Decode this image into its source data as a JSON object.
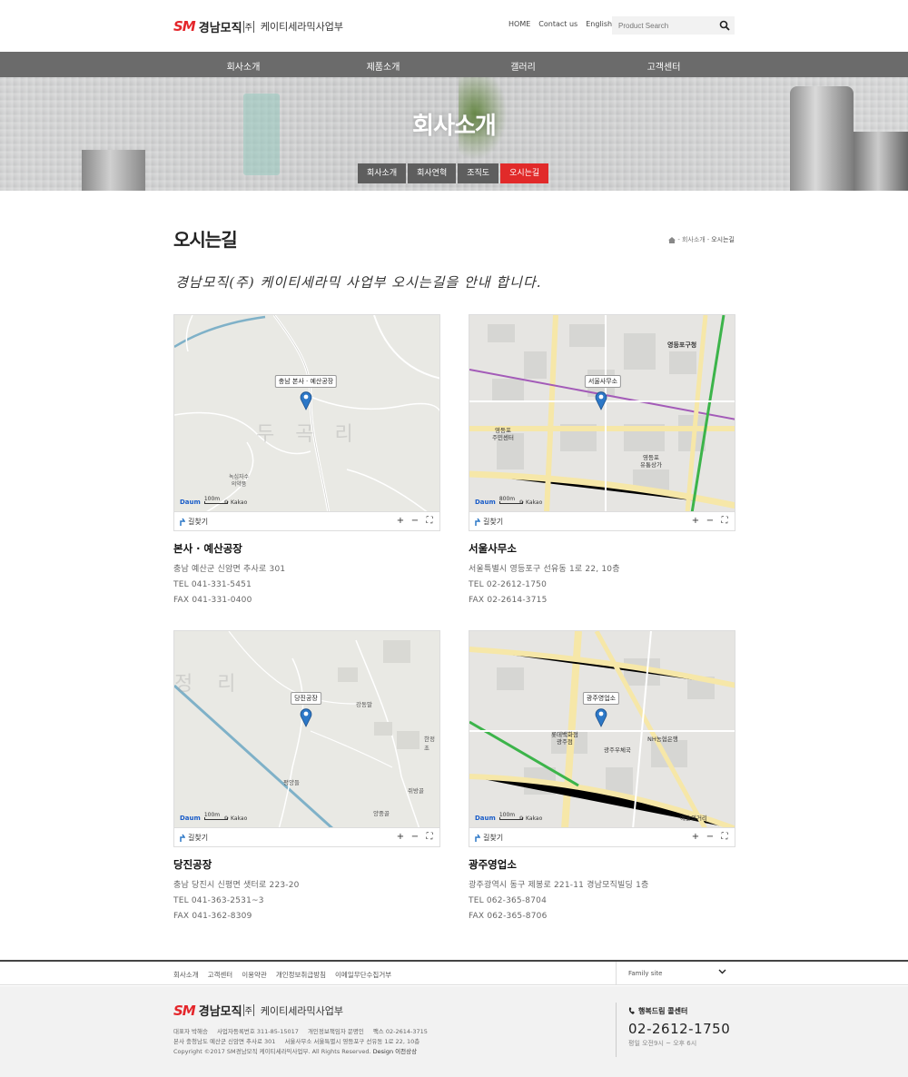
{
  "header": {
    "logo_sm": "SM",
    "logo_name": "경남모직",
    "logo_co": "주",
    "logo_division": "케이티세라믹사업부",
    "top_links": [
      "HOME",
      "Contact us",
      "English"
    ],
    "search_placeholder": "Product Search"
  },
  "gnb": [
    "회사소개",
    "제품소개",
    "갤러리",
    "고객센터"
  ],
  "hero": {
    "title": "회사소개",
    "tabs": [
      "회사소개",
      "회사연혁",
      "조직도",
      "오시는길"
    ],
    "active_tab": "오시는길"
  },
  "content": {
    "page_title": "오시는길",
    "breadcrumb": [
      "회사소개",
      "오시는길"
    ],
    "intro": "경남모직(주) 케이티세라믹 사업부 오시는길을 안내 합니다."
  },
  "map_ui": {
    "findway_label": "길찾기",
    "daum_label": "Daum",
    "kakao_label": "© Kakao",
    "scale_100": "100m",
    "scale_800": "800m",
    "watermark_1": "두 곡 리",
    "watermark_2": "정 리"
  },
  "locations": [
    {
      "name": "본사 · 예산공장",
      "pin_label": "충남 본사 · 예산공장",
      "address": "충남 예산군 신암면 추사로 301",
      "tel": "TEL 041-331-5451",
      "fax": "FAX 041-331-0400",
      "scale": "100m"
    },
    {
      "name": "서울사무소",
      "pin_label": "서울사무소",
      "address": "서울특별시 영등포구 선유동 1로 22, 10층",
      "tel": "TEL 02-2612-1750",
      "fax": "FAX 02-2614-3715",
      "scale": "800m"
    },
    {
      "name": "당진공장",
      "pin_label": "당진공장",
      "address": "충남 당진시 신평면 샛터로 223-20",
      "tel": "TEL 041-363-2531~3",
      "fax": "FAX 041-362-8309",
      "scale": "100m"
    },
    {
      "name": "광주영업소",
      "pin_label": "광주영업소",
      "address": "광주광역시 동구 제봉로 221-11 경남모직빌딩 1층",
      "tel": "TEL 062-365-8704",
      "fax": "FAX 062-365-8706",
      "scale": "100m"
    }
  ],
  "footer": {
    "links": [
      "회사소개",
      "고객센터",
      "이용약관",
      "개인정보취급방침",
      "이메일무단수집거부"
    ],
    "family_site": "Family site",
    "info_row1": [
      "대표자 박해승",
      "사업자등록번호 311-85-15017",
      "개인정보책임자 문명인",
      "팩스 02-2614-3715"
    ],
    "info_row2": [
      "본사 충청남도 예산군 신암면 추사로 301",
      "서울사무소 서울특별시 영등포구 선유동 1로 22, 10층"
    ],
    "copyright": "Copyright ©2017 SM경남모직 케이티세라믹사업부. All Rights Reserved.",
    "design": "Design 이천상상",
    "call_label": "행복드림 콜센터",
    "call_number": "02-2612-1750",
    "call_hours": "평일 오전9시 ~ 오후 6시"
  },
  "colors": {
    "accent_red": "#e12a2a",
    "gnb_gray": "#6b6b6b"
  }
}
